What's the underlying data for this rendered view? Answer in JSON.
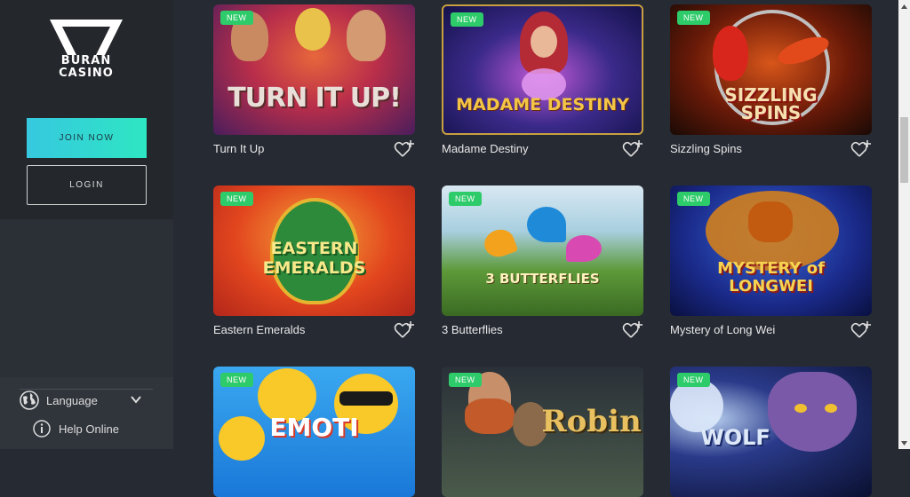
{
  "brand": {
    "line1": "BURAN",
    "line2": "CASINO"
  },
  "auth": {
    "join_label": "JOIN NOW",
    "login_label": "LOGIN"
  },
  "footer": {
    "language_label": "Language",
    "help_label": "Help Online"
  },
  "badge_label": "NEW",
  "games": [
    {
      "name": "Turn It Up",
      "art": "TURN IT UP!",
      "badge": "NEW"
    },
    {
      "name": "Madame Destiny",
      "art": "MADAME DESTINY",
      "badge": "NEW"
    },
    {
      "name": "Sizzling Spins",
      "art": "SIZZLING SPINS",
      "badge": "NEW"
    },
    {
      "name": "Eastern Emeralds",
      "art": "EASTERN EMERALDS",
      "badge": "NEW"
    },
    {
      "name": "3 Butterflies",
      "art": "3 BUTTERFLIES",
      "badge": "NEW"
    },
    {
      "name": "Mystery of Long Wei",
      "art": "MYSTERY of LONGWEI",
      "badge": "NEW"
    },
    {
      "name": "",
      "art": "EMOTI",
      "badge": "NEW"
    },
    {
      "name": "",
      "art": "Robin",
      "badge": "NEW"
    },
    {
      "name": "",
      "art": "WOLF",
      "badge": "NEW"
    }
  ],
  "icons": {
    "language": "globe-icon",
    "chevron": "chevron-down-icon",
    "help": "info-icon",
    "favorite": "heart-plus-icon"
  },
  "colors": {
    "accent_from": "#36c8e0",
    "accent_to": "#2ee6c2",
    "badge": "#2ecb6a",
    "background": "#262a33"
  }
}
